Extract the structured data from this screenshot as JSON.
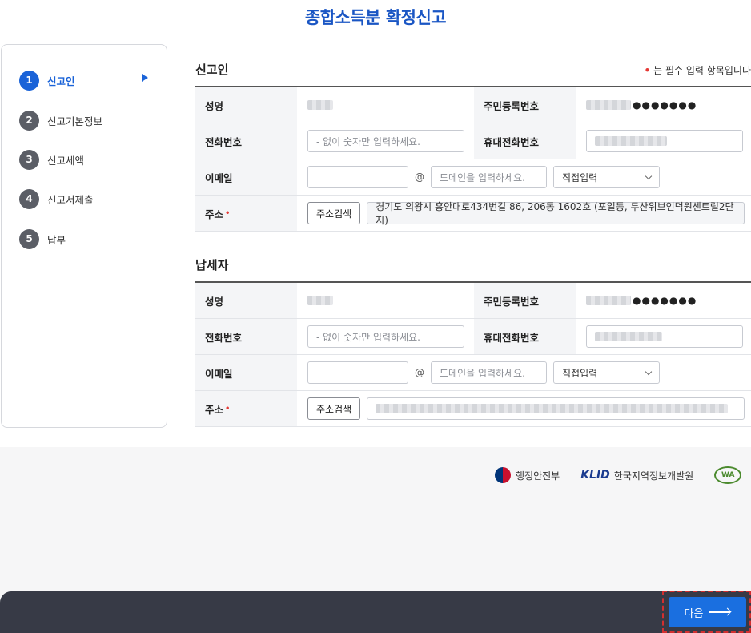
{
  "page_title": "종합소득분 확정신고",
  "stepper": {
    "steps": [
      {
        "num": "1",
        "label": "신고인"
      },
      {
        "num": "2",
        "label": "신고기본정보"
      },
      {
        "num": "3",
        "label": "신고세액"
      },
      {
        "num": "4",
        "label": "신고서제출"
      },
      {
        "num": "5",
        "label": "납부"
      }
    ]
  },
  "required_note": "는 필수 입력 항목입니다",
  "reporter": {
    "title": "신고인",
    "name_label": "성명",
    "rrn_label": "주민등록번호",
    "rrn_mask": "●●●●●●●",
    "phone_label": "전화번호",
    "phone_placeholder": "- 없이 숫자만 입력하세요.",
    "mobile_label": "휴대전화번호",
    "email_label": "이메일",
    "email_at": "@",
    "domain_placeholder": "도메인을 입력하세요.",
    "domain_select": "직접입력",
    "address_label": "주소",
    "address_search": "주소검색",
    "address_value": "경기도 의왕시 흥안대로434번길 86, 206동 1602호 (포일동, 두산위브인덕원센트럴2단지)"
  },
  "taxpayer": {
    "title": "납세자",
    "name_label": "성명",
    "rrn_label": "주민등록번호",
    "rrn_mask": "●●●●●●●",
    "phone_label": "전화번호",
    "phone_placeholder": "- 없이 숫자만 입력하세요.",
    "mobile_label": "휴대전화번호",
    "email_label": "이메일",
    "email_at": "@",
    "domain_placeholder": "도메인을 입력하세요.",
    "domain_select": "직접입력",
    "address_label": "주소",
    "address_search": "주소검색"
  },
  "required_mark": "•",
  "footer": {
    "gov_name": "행정안전부",
    "klid_mark": "KLID",
    "klid_name": "한국지역정보개발원",
    "wa_mark": "WA"
  },
  "next_button": "다음"
}
